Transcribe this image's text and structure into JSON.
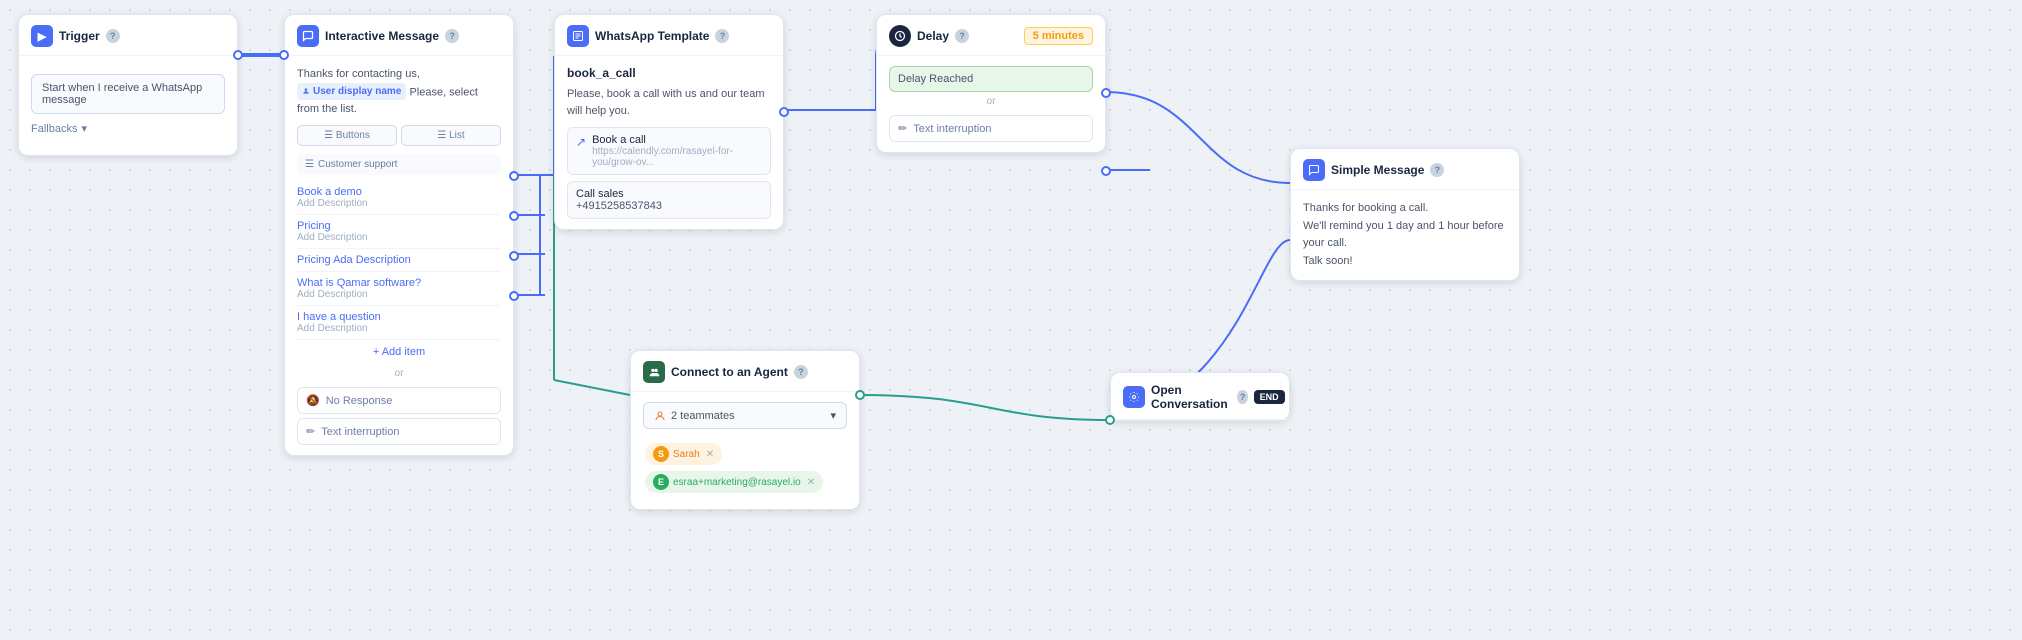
{
  "trigger": {
    "title": "Trigger",
    "input_value": "Start when I receive a WhatsApp message",
    "fallbacks_label": "Fallbacks"
  },
  "interactive": {
    "title": "Interactive Message",
    "body_text": "Thanks for contacting us,",
    "user_tag": "User display name",
    "body_suffix": "Please, select from the list.",
    "tab_buttons": "Buttons",
    "tab_list": "List",
    "section_label": "Customer support",
    "items": [
      {
        "title": "Book a demo",
        "desc": "Add Description"
      },
      {
        "title": "Pricing",
        "desc": "Add Description"
      },
      {
        "title": "Pricing Ada Description",
        "desc": ""
      },
      {
        "title": "What is Qamar software?",
        "desc": "Add Description"
      },
      {
        "title": "I have a question",
        "desc": "Add Description"
      }
    ],
    "add_item": "+ Add item",
    "or_label": "or",
    "no_response": "No Response",
    "text_interruption": "Text interruption"
  },
  "whatsapp": {
    "title": "WhatsApp Template",
    "template_name": "book_a_call",
    "body": "Please, book a call with us and our team will help you.",
    "link_title": "Book a call",
    "link_url": "https://calendly.com/rasayel-for-you/grow-ov...",
    "phone_label": "Call sales",
    "phone_number": "+4915258537843"
  },
  "delay": {
    "title": "Delay",
    "badge": "5 minutes",
    "reached_label": "Delay Reached",
    "or_label": "or",
    "interruption_label": "Text interruption"
  },
  "simple": {
    "title": "Simple Message",
    "body": "Thanks for booking a call.\nWe'll remind you 1 day and 1 hour before your call.\nTalk soon!"
  },
  "agent": {
    "title": "Connect to an Agent",
    "teammates_count": "2 teammates",
    "chip1": "Sarah",
    "chip2": "esraa+marketing@rasayel.io"
  },
  "open_conv": {
    "title": "Open Conversation",
    "end_badge": "END"
  },
  "icons": {
    "trigger": "▶",
    "interactive": "💬",
    "whatsapp": "📄",
    "delay": "⏱",
    "simple": "💬",
    "agent": "👥",
    "open_conv": "⚙",
    "chevron_down": "▾",
    "link_ext": "↗",
    "phone": "📞",
    "grid": "⊞",
    "no_response": "🔕",
    "text_int": "✏",
    "info": "?"
  }
}
